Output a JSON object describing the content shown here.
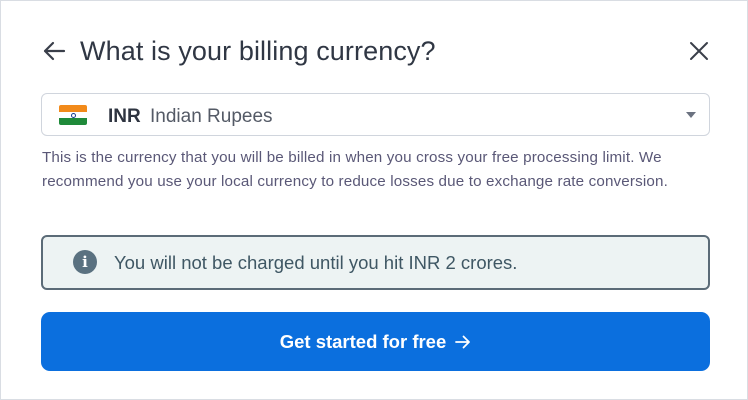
{
  "dialog": {
    "title": "What is your billing currency?",
    "back_icon": "arrow-left-icon",
    "close_icon": "close-icon"
  },
  "currency_select": {
    "flag_icon": "india-flag-icon",
    "code": "INR",
    "name": "Indian Rupees",
    "caret_icon": "caret-down-icon"
  },
  "help_text": "This is the currency that you will be billed in when you cross your free processing limit. We recommend you use your local currency to reduce losses due to exchange rate conversion.",
  "notice": {
    "icon": "info-icon",
    "icon_glyph": "i",
    "text": "You will not be charged until you hit INR 2 crores."
  },
  "cta": {
    "label": "Get started for free",
    "arrow_icon": "arrow-right-icon"
  },
  "colors": {
    "primary": "#0b6fde",
    "notice_bg": "#edf3f3",
    "notice_border": "#5b6b77",
    "help_text": "#5a5877"
  }
}
